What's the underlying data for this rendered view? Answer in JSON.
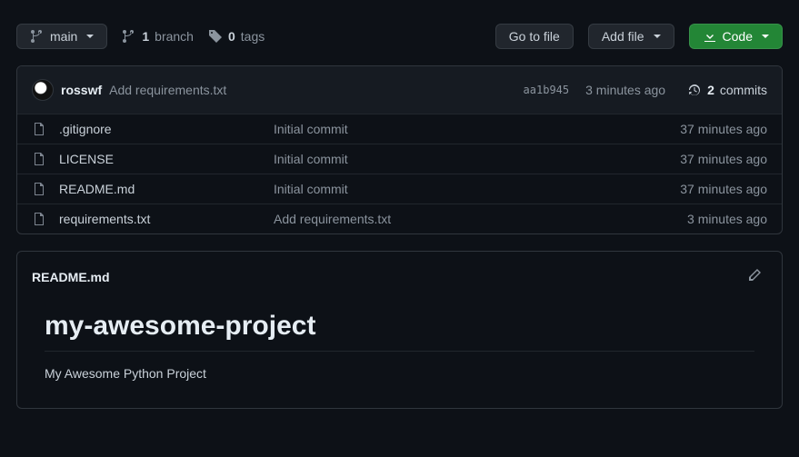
{
  "toolbar": {
    "branch_label": "main",
    "branch_count": "1",
    "branch_suffix": "branch",
    "tag_count": "0",
    "tag_suffix": "tags",
    "goto_file": "Go to file",
    "add_file": "Add file",
    "code": "Code"
  },
  "latest_commit": {
    "author": "rosswf",
    "message": "Add requirements.txt",
    "sha": "aa1b945",
    "time": "3 minutes ago",
    "commits_count": "2",
    "commits_suffix": "commits"
  },
  "files": [
    {
      "name": ".gitignore",
      "msg": "Initial commit",
      "time": "37 minutes ago"
    },
    {
      "name": "LICENSE",
      "msg": "Initial commit",
      "time": "37 minutes ago"
    },
    {
      "name": "README.md",
      "msg": "Initial commit",
      "time": "37 minutes ago"
    },
    {
      "name": "requirements.txt",
      "msg": "Add requirements.txt",
      "time": "3 minutes ago"
    }
  ],
  "readme": {
    "filename": "README.md",
    "heading": "my-awesome-project",
    "description": "My Awesome Python Project"
  }
}
